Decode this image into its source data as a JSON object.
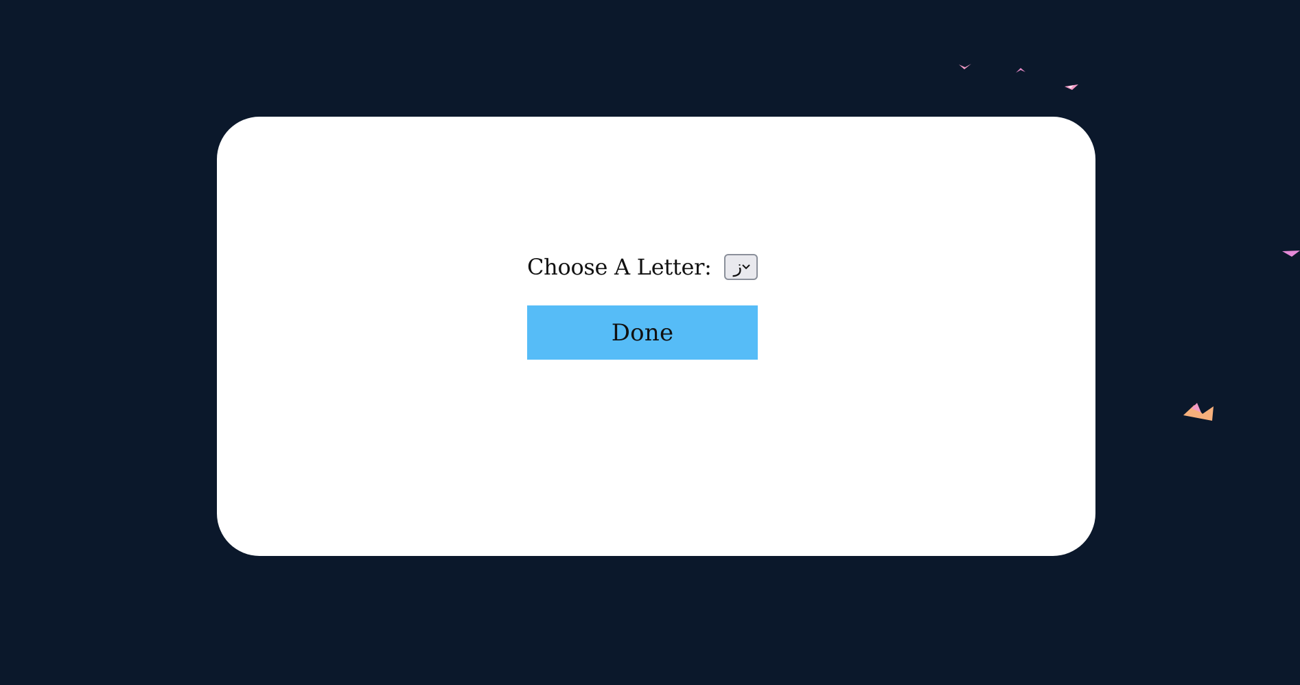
{
  "form": {
    "label": "Choose A Letter:",
    "selected_letter": "ز",
    "done_label": "Done"
  },
  "colors": {
    "background": "#0b182b",
    "card": "#ffffff",
    "button": "#56bcf7",
    "confetti_pink": "#f29ac6",
    "confetti_orange": "#f7b07c"
  },
  "icons": {
    "dropdown": "chevron-down-icon",
    "confetti": "confetti-icon"
  }
}
